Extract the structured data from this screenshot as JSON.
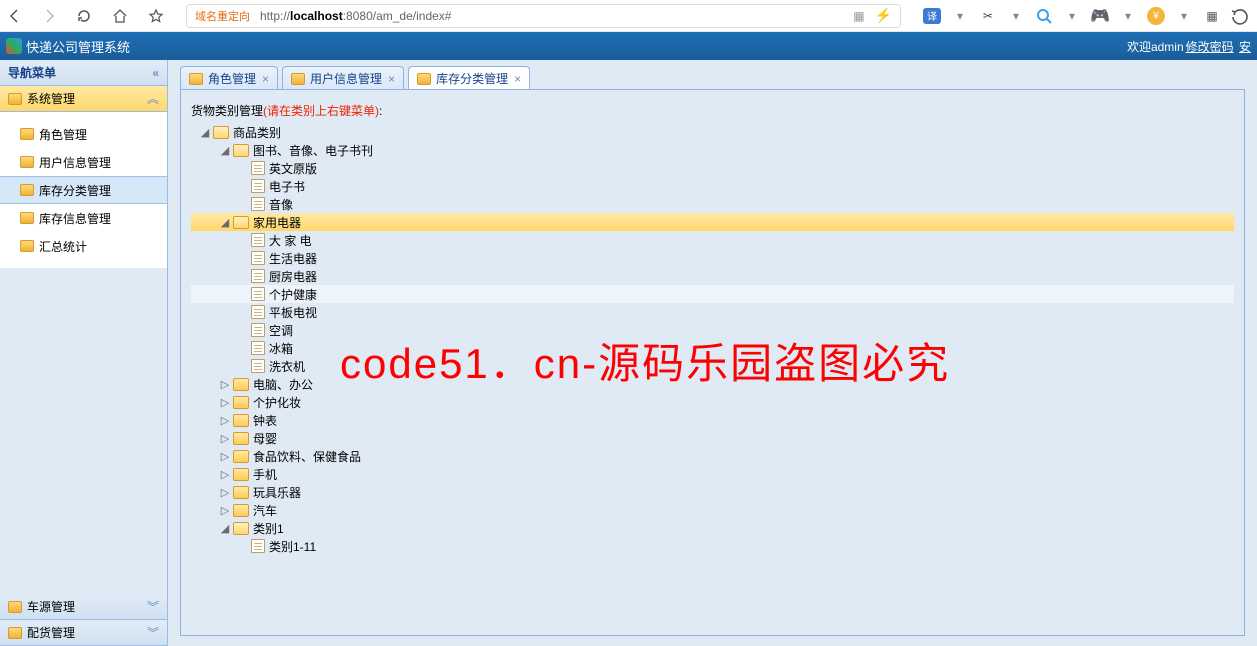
{
  "browser": {
    "redirect_label": "域名重定向",
    "url_prefix": "http://",
    "url_host": "localhost",
    "url_rest": ":8080/am_de/index#"
  },
  "header": {
    "title": "快递公司管理系统",
    "welcome": "欢迎admin",
    "change_pw": "修改密码",
    "safe": "安"
  },
  "sidebar": {
    "title": "导航菜单",
    "groups": {
      "sys": "系统管理",
      "car": "车源管理",
      "dist": "配货管理"
    },
    "items": {
      "role": "角色管理",
      "user": "用户信息管理",
      "stockcat": "库存分类管理",
      "stockinfo": "库存信息管理",
      "stats": "汇总统计"
    }
  },
  "tabs": {
    "role": "角色管理",
    "user": "用户信息管理",
    "stockcat": "库存分类管理"
  },
  "content": {
    "crumb": "货物类别管理",
    "hint": "(请在类别上右键菜单)",
    "colon": ":"
  },
  "tree": {
    "root": "商品类别",
    "books": "图书、音像、电子书刊",
    "books_c": {
      "a": "英文原版",
      "b": "电子书",
      "c": "音像"
    },
    "appl": "家用电器",
    "appl_c": {
      "a": "大 家 电",
      "b": "生活电器",
      "c": "厨房电器",
      "d": "个护健康",
      "e": "平板电视",
      "f": "空调",
      "g": "冰箱",
      "h": "洗衣机"
    },
    "pc": "电脑、办公",
    "care": "个护化妆",
    "watch": "钟表",
    "baby": "母婴",
    "food": "食品饮料、保健食品",
    "phone": "手机",
    "toy": "玩具乐器",
    "car": "汽车",
    "cat1": "类别1",
    "cat1_c": {
      "a": "类别1-11"
    }
  },
  "watermark": "code51．cn-源码乐园盗图必究"
}
